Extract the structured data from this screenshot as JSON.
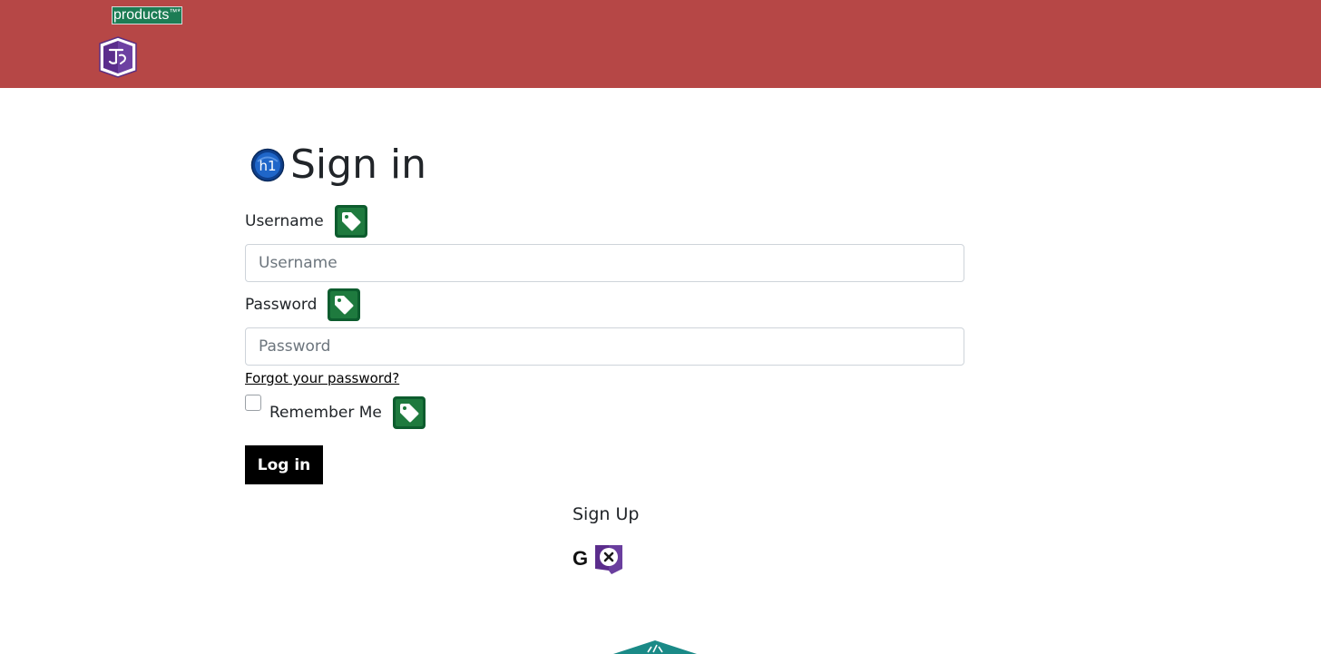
{
  "header": {
    "badge_text": "products",
    "badge_sup": "™*",
    "logo_icon": "brand-shield-logo",
    "background_color": "#b64746"
  },
  "main": {
    "heading_icon": "h1-icon",
    "title": "Sign in",
    "username": {
      "label": "Username",
      "placeholder": "Username",
      "value": ""
    },
    "password": {
      "label": "Password",
      "placeholder": "Password",
      "value": ""
    },
    "forgot_link": "Forgot your password?",
    "remember_label": "Remember Me",
    "remember_checked": false,
    "login_label": "Log in",
    "tag_icon": "tag-icon"
  },
  "signup": {
    "label": "Sign Up",
    "google_glyph": "G",
    "icons": [
      "google-icon",
      "close-badge-icon"
    ]
  },
  "footer": {
    "logo_icon": "code-logo-icon"
  }
}
